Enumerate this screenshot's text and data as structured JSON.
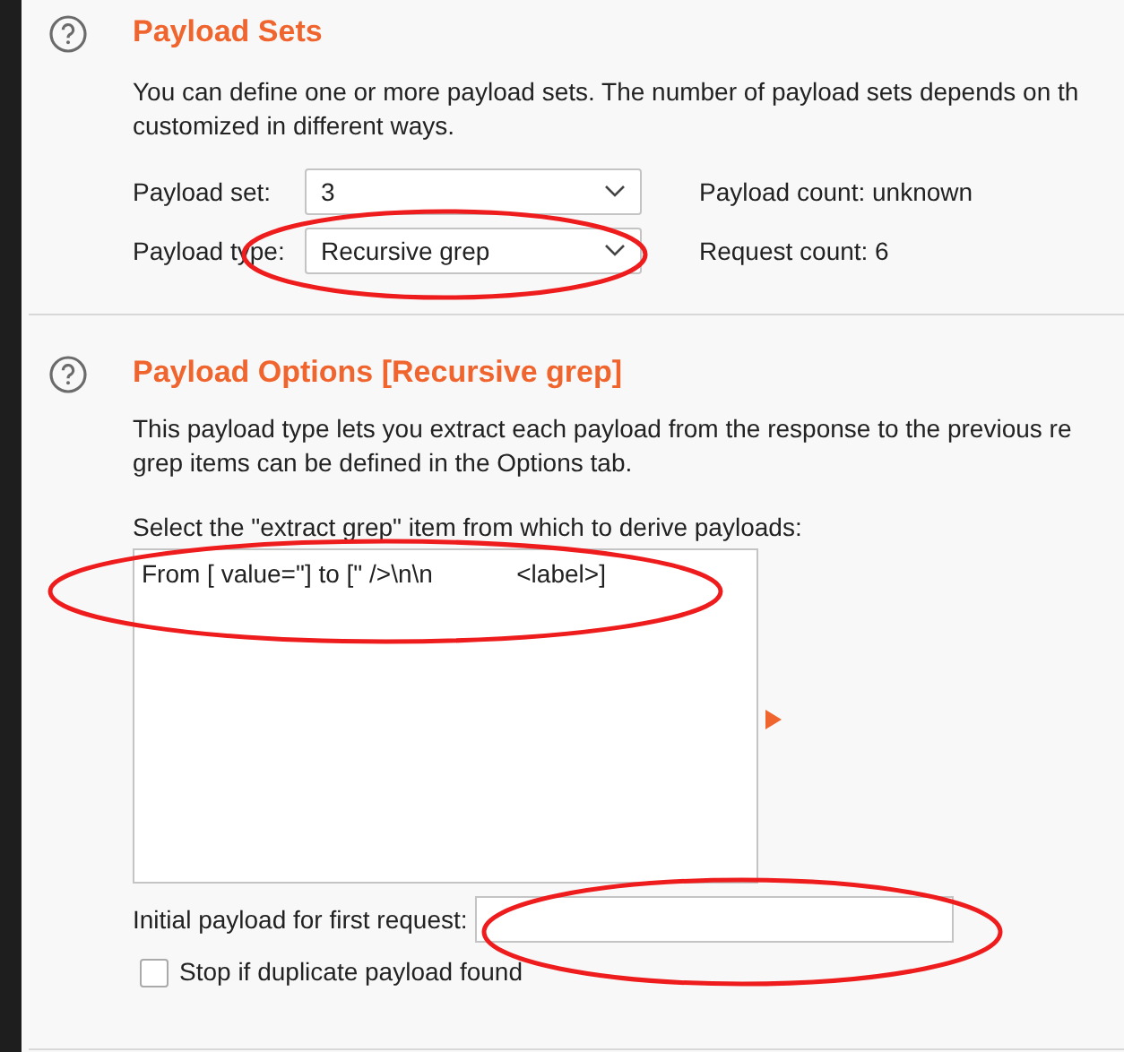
{
  "payload_sets": {
    "title": "Payload Sets",
    "description_lines": [
      "You can define one or more payload sets. The number of payload sets depends on th",
      "customized in different ways."
    ],
    "fields": [
      {
        "label": "Payload set:",
        "value": "3",
        "info": "Payload count: unknown"
      },
      {
        "label": "Payload type:",
        "value": "Recursive grep",
        "info": "Request count: 6"
      }
    ]
  },
  "payload_options": {
    "title": "Payload Options [Recursive grep]",
    "description_lines": [
      "This payload type lets you extract each payload from the response to the previous re",
      "grep items can be defined in the Options tab."
    ],
    "list_label": "Select the \"extract grep\" item from which to derive payloads:",
    "list_items": [
      {
        "text": "From [ value=\"] to [\" />\\n\\n            <label>]",
        "selected": false
      }
    ],
    "initial_payload": {
      "label": "Initial payload for first request:"
    },
    "stop_duplicates": {
      "label": "Stop if duplicate payload found",
      "checked": false
    }
  }
}
